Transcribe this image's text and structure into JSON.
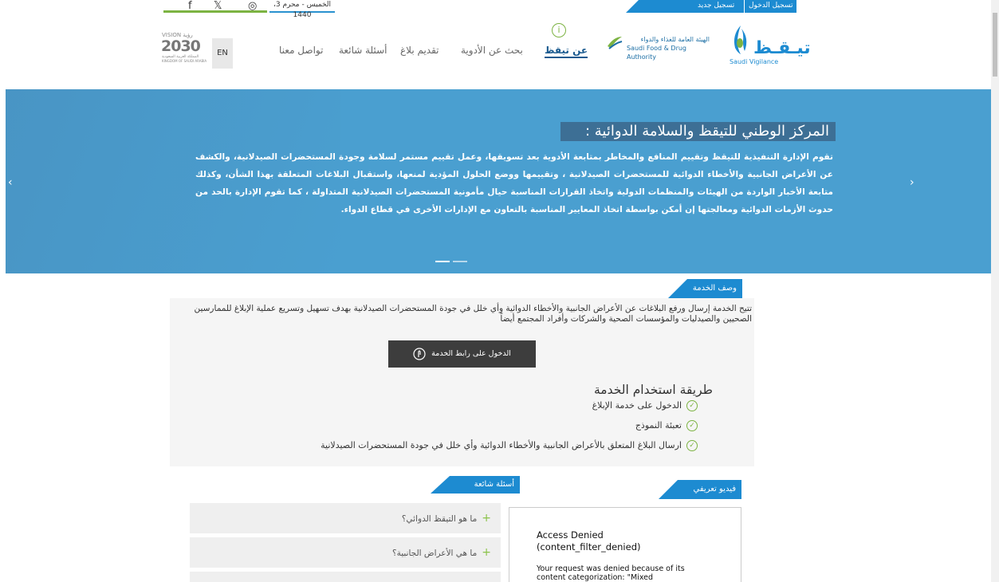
{
  "topbar": {
    "social": [
      "f",
      "𝕏",
      "◎"
    ],
    "date": "الخميس - محرم 3، 1440",
    "login": "تسجيل الدخول",
    "register": "تسجيل جديد"
  },
  "header": {
    "lang_button": "EN",
    "nav": [
      {
        "label": "عن تيقظ",
        "active": true
      },
      {
        "label": "بحث عن الأدوية",
        "active": false
      },
      {
        "label": "تقديم بلاغ",
        "active": false
      },
      {
        "label": "أسئلة شائعة",
        "active": false
      },
      {
        "label": "تواصل معنا",
        "active": false
      }
    ],
    "sfda_ar": "الهيئة العامة للغذاء والدواء",
    "sfda_en": "Saudi Food & Drug Authority",
    "sv_ar": "تيـقـظ",
    "sv_en": "Saudi Vigilance",
    "vision_top": "VISION رؤية",
    "vision_year": "2030",
    "vision_sub": "المملكة العربية السعودية",
    "vision_sub2": "KINGDOM OF SAUDI ARABIA"
  },
  "hero": {
    "title": "المركز الوطني للتيقظ والسلامة الدوائية :",
    "body": "تقوم الإدارة التنفيذية للتيقظ وتقييم المنافع والمخاطر بمتابعة الأدوية بعد تسويقها، وعمل تقييم مستمر لسلامة وجودة المستحضرات الصيدلانية، والكشف عن الأعراض الجانبية والأخطاء الدوائية للمستحضرات الصيدلانية ، وتقييمها ووضع الحلول المؤدية لمنعها، واستقبال البلاغات المتعلقة بهذا الشأن، وكذلك متابعة الأخبار الواردة من الهيئات والمنظمات الدولية واتخاذ القرارات المناسبة حيال مأمونية المستحضرات الصيدلانية المتداولة ، كما تقوم الإدارة بالحد من حدوث الأزمات الدوائية ومعالجتها إن أمكن بواسطة اتخاذ المعايير المناسبة بالتعاون مع الإدارات الأخرى في قطاع الدواء.",
    "prev": "‹",
    "next": "›"
  },
  "service": {
    "tab": "وصف الخدمة",
    "description": "تتيح الخدمة إرسال ورفع البلاغات عن الأعراض الجانبية والأخطاء الدوائية وأي خلل في جودة المستحضرات الصيدلانية بهدف تسهيل وتسريع عملية الإبلاغ للممارسين الصحيين والصيدليات والمؤسسات الصحية والشركات وأفراد المجتمع أيضاً",
    "button": "الدخول على رابط الخدمة",
    "how_title": "طريقة استخدام الخدمة",
    "steps": [
      "الدخول على خدمة الإبلاغ",
      "تعبئة النموذج",
      "ارسال البلاغ المتعلق بالأعراض الجانبية والأخطاء الدوائية وأي خلل في جودة المستحضرات الصيدلانية"
    ]
  },
  "faq": {
    "tab": "أسئلة شائعة",
    "items": [
      "ما هو التيقظ الدوائي؟",
      "ما هي الأعراض الجانبية؟"
    ]
  },
  "video": {
    "tab": "فيديو تعريفي",
    "error_title": "Access Denied",
    "error_code": "(content_filter_denied)",
    "error_body": "Your request was denied because of its content categorization: \"Mixed"
  }
}
